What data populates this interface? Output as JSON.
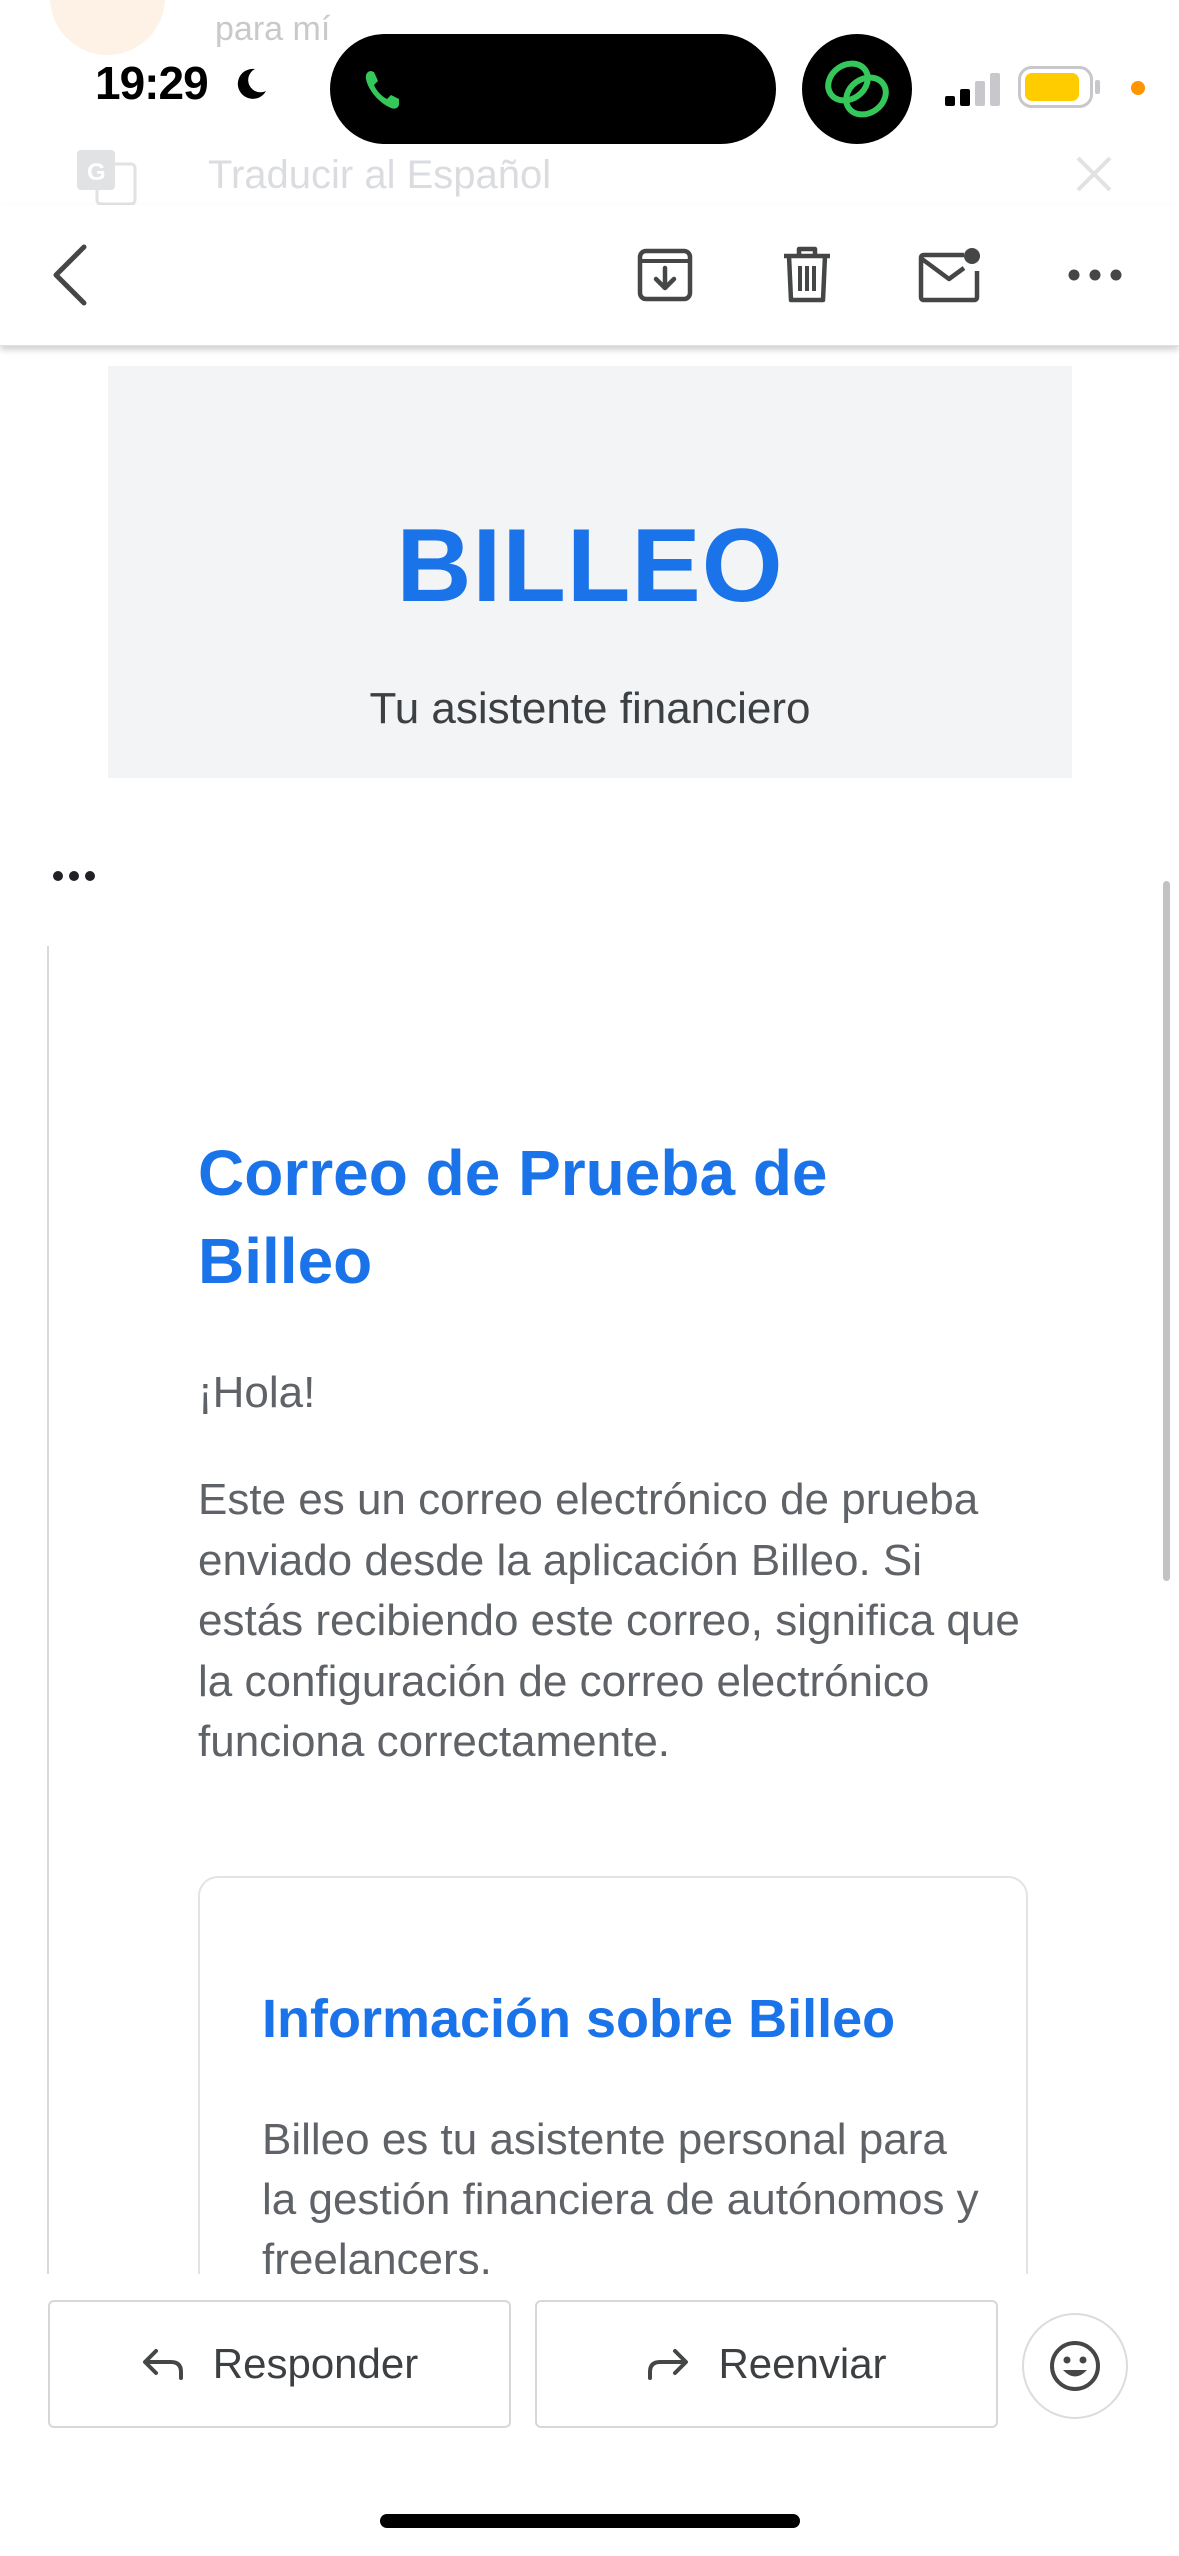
{
  "status_bar": {
    "time": "19:29",
    "peek_text": "para mí",
    "colors": {
      "call_green": "#34c759",
      "battery_yellow": "#ffcc00",
      "privacy_dot": "#ff9500"
    }
  },
  "translate_banner": {
    "label": "Traducir al Español",
    "icon": "google-translate-icon"
  },
  "toolbar": {
    "back_icon": "chevron-left-icon",
    "archive_icon": "archive-icon",
    "delete_icon": "trash-icon",
    "mark_unread_icon": "mail-unread-icon",
    "more_icon": "more-horizontal-icon"
  },
  "email": {
    "brand": {
      "name": "BILLEO",
      "tagline": "Tu asistente financiero",
      "color": "#1a73e8",
      "header_bg": "#f3f4f6"
    },
    "heading": "Correo de Prueba de Billeo",
    "greeting": "¡Hola!",
    "body": "Este es un correo electrónico de prueba enviado desde la aplicación Billeo. Si estás recibiendo este correo, significa que la configuración de correo electrónico funciona correctamente.",
    "info_card": {
      "title": "Información sobre Billeo",
      "text": "Billeo es tu asistente personal para la gestión financiera de autónomos y freelancers."
    }
  },
  "actions": {
    "reply_label": "Responder",
    "forward_label": "Reenviar",
    "emoji_icon": "emoji-smile-icon"
  }
}
